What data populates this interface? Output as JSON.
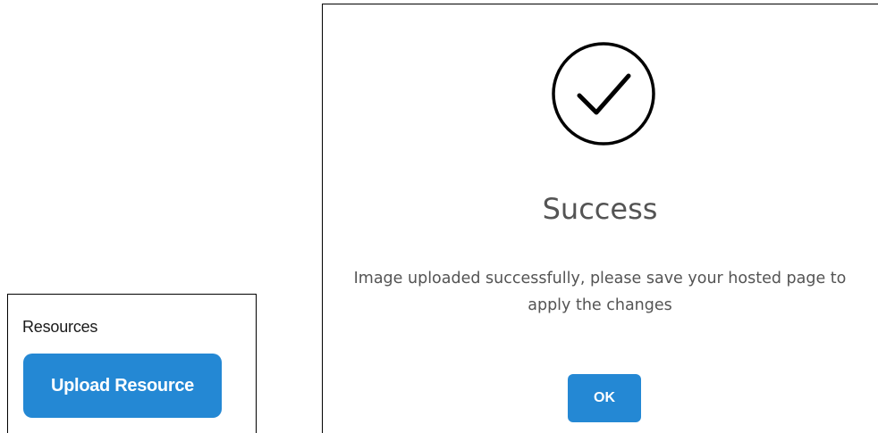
{
  "resources": {
    "title": "Resources",
    "upload_button_label": "Upload Resource"
  },
  "dialog": {
    "icon": "checkmark-circle-icon",
    "title": "Success",
    "message": "Image uploaded successfully, please save your hosted page to apply the changes",
    "ok_label": "OK"
  },
  "colors": {
    "primary_button": "#2488d4",
    "dialog_text": "#545454",
    "icon_stroke": "#000000"
  }
}
